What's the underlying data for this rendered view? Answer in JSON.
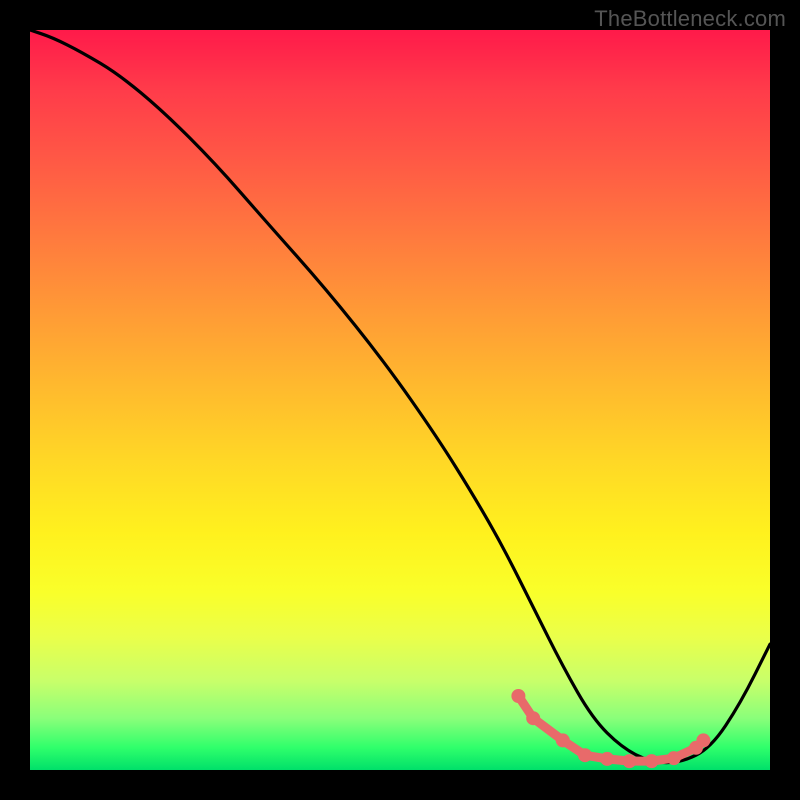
{
  "watermark": "TheBottleneck.com",
  "chart_data": {
    "type": "line",
    "title": "",
    "xlabel": "",
    "ylabel": "",
    "xlim": [
      0,
      100
    ],
    "ylim": [
      0,
      100
    ],
    "grid": false,
    "legend": false,
    "series": [
      {
        "name": "curve",
        "x": [
          0,
          3,
          7,
          12,
          18,
          25,
          32,
          40,
          48,
          55,
          60,
          64,
          68,
          72,
          76,
          80,
          84,
          88,
          92,
          96,
          100
        ],
        "y": [
          100,
          99,
          97,
          94,
          89,
          82,
          74,
          65,
          55,
          45,
          37,
          30,
          22,
          14,
          7,
          3,
          1,
          1,
          3,
          9,
          17
        ]
      }
    ],
    "markers": [
      {
        "x": 66,
        "y": 10
      },
      {
        "x": 68,
        "y": 7
      },
      {
        "x": 72,
        "y": 4
      },
      {
        "x": 75,
        "y": 2
      },
      {
        "x": 78,
        "y": 1.5
      },
      {
        "x": 81,
        "y": 1.2
      },
      {
        "x": 84,
        "y": 1.2
      },
      {
        "x": 87,
        "y": 1.6
      },
      {
        "x": 90,
        "y": 3
      },
      {
        "x": 91,
        "y": 4
      }
    ],
    "color_scheme": {
      "top": "#ff1a4a",
      "mid": "#fff11e",
      "bottom": "#00e06a",
      "curve": "#000000",
      "marker": "#e86a6a",
      "frame": "#000000"
    }
  }
}
